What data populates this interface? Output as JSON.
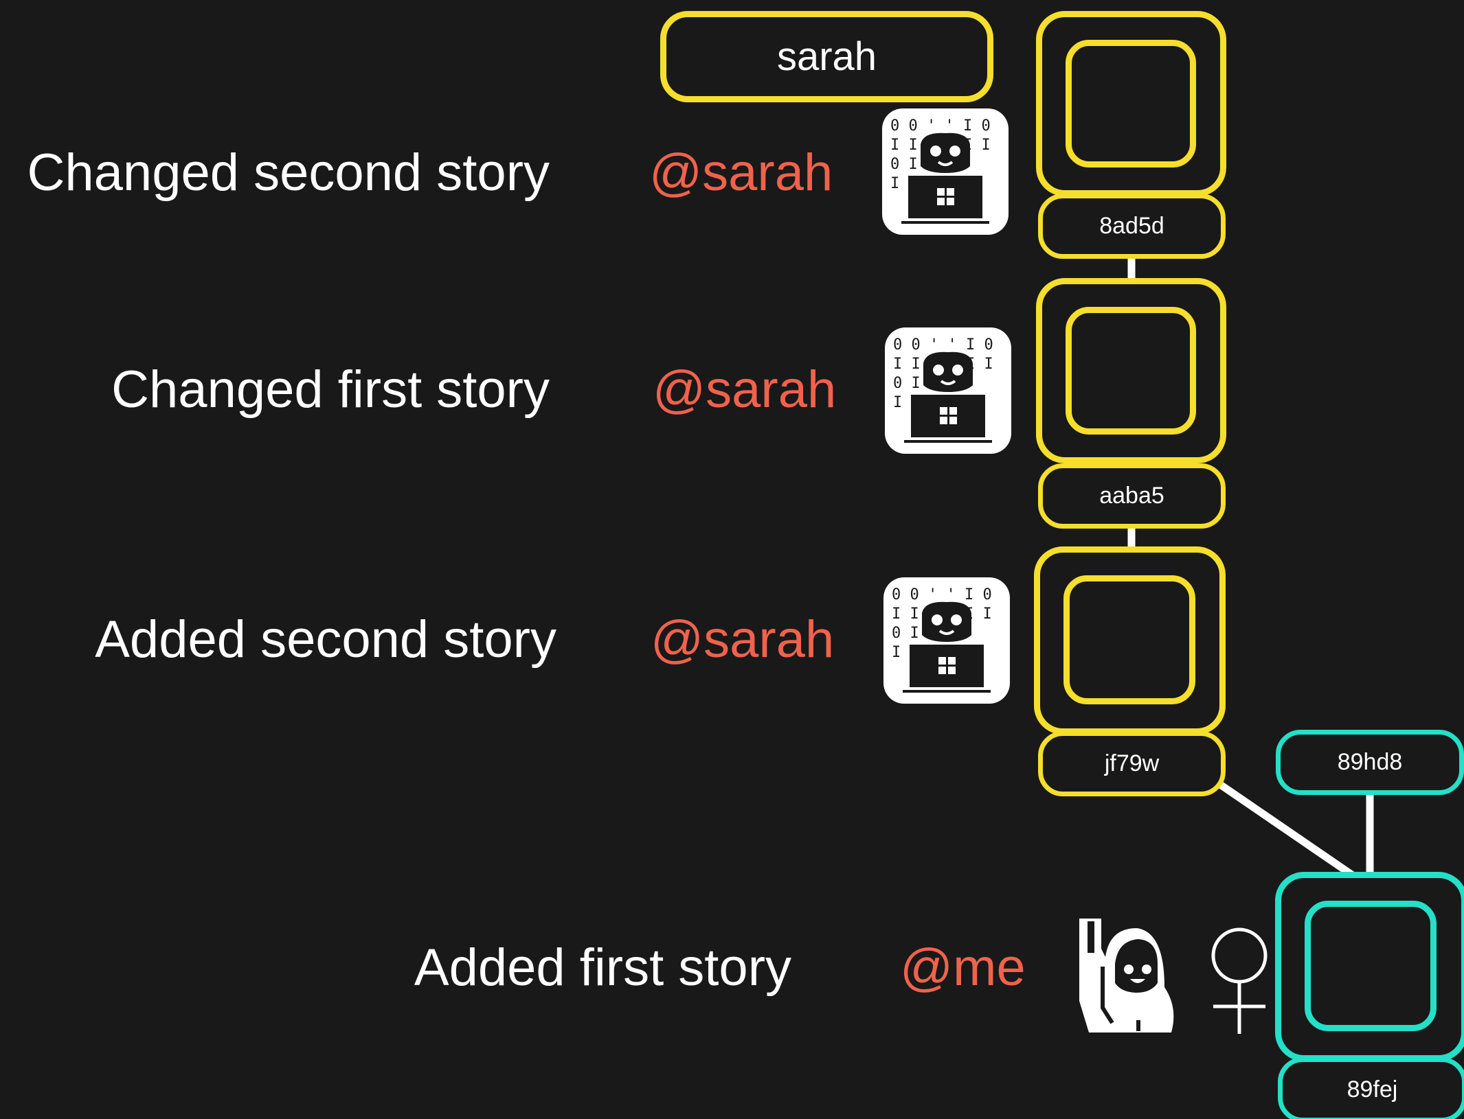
{
  "branch": {
    "name": "sarah"
  },
  "commits": [
    {
      "message": "Changed second story",
      "author": "@sarah",
      "hash": "8ad5d",
      "avatar": "developer-laptop-icon",
      "color": "#f5de2c"
    },
    {
      "message": "Changed first story",
      "author": "@sarah",
      "hash": "aaba5",
      "avatar": "developer-laptop-icon",
      "color": "#f5de2c"
    },
    {
      "message": "Added second story",
      "author": "@sarah",
      "hash": "jf79w",
      "avatar": "developer-laptop-icon",
      "color": "#f5de2c"
    },
    {
      "message": "Added first story",
      "author": "@me",
      "hash": "89fej",
      "avatar": "person-raising-hand-icon",
      "color": "#24e0c8"
    }
  ],
  "merge_commit": {
    "hash": "89hd8",
    "color": "#24e0c8"
  },
  "colors": {
    "background": "#191919",
    "sarah_branch": "#f5de2c",
    "main_branch": "#24e0c8",
    "author_text": "#f0624c",
    "text": "#ffffff"
  },
  "icons": [
    "developer-laptop-icon",
    "person-raising-hand-icon",
    "female-sign-icon"
  ]
}
